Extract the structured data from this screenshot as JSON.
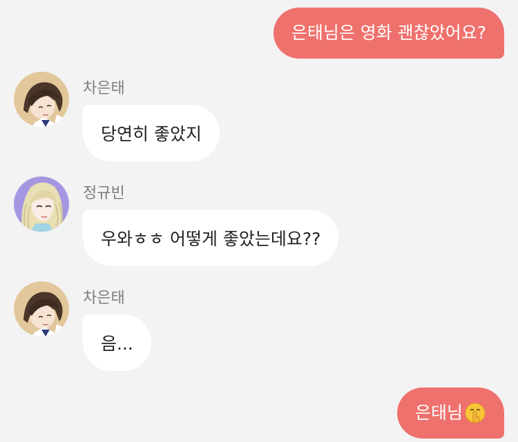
{
  "messages": [
    {
      "direction": "out",
      "text": "은태님은 영화 괜찮았어요?"
    },
    {
      "direction": "in",
      "sender": "차은태",
      "avatar": "boy-avatar",
      "text": "당연히 좋았지"
    },
    {
      "direction": "in",
      "sender": "정규빈",
      "avatar": "girl-avatar",
      "text": "우와ㅎㅎ 어떻게 좋았는데요??"
    },
    {
      "direction": "in",
      "sender": "차은태",
      "avatar": "boy-avatar",
      "text": "음..."
    },
    {
      "direction": "out",
      "text": "은태님",
      "emoji": "shushing-face-emoji"
    }
  ],
  "colors": {
    "background": "#f3f3f3",
    "outgoing_bubble": "#ef716d",
    "incoming_bubble": "#ffffff",
    "sender_name": "#7d7d7d"
  }
}
